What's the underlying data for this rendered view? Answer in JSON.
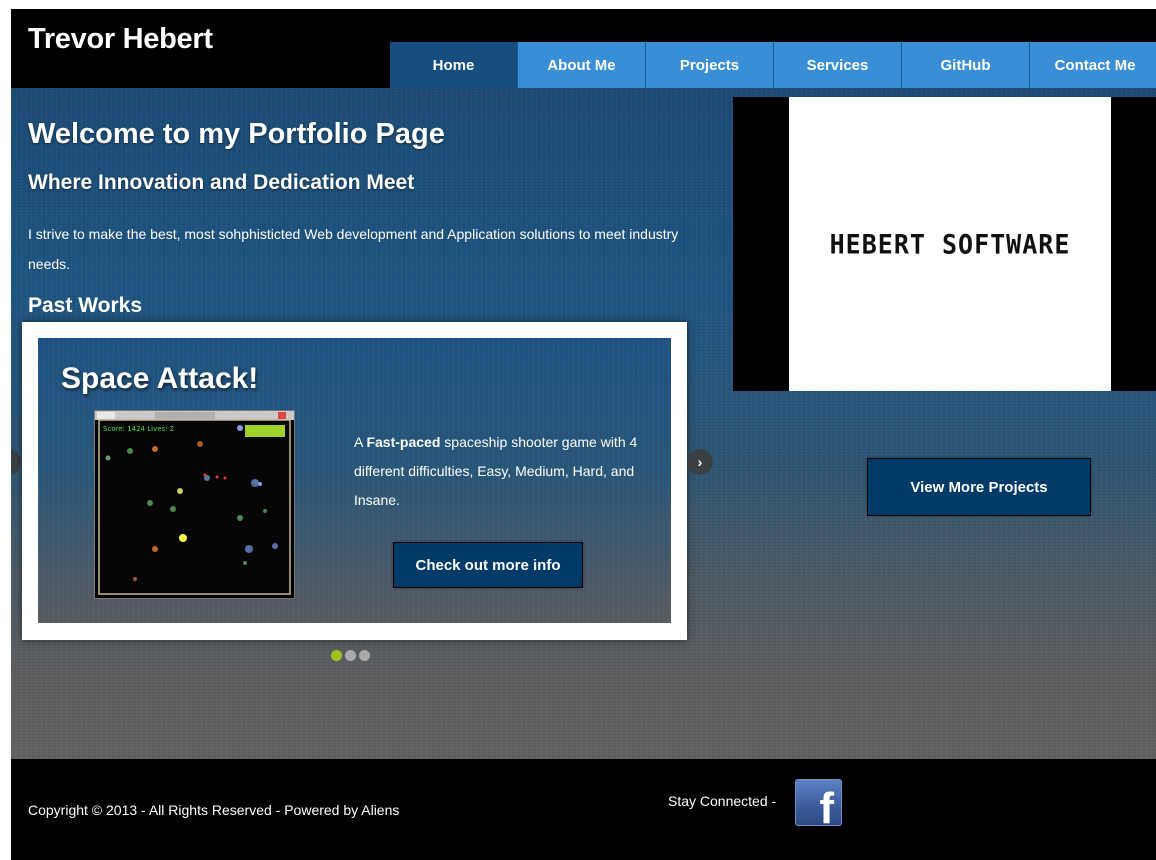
{
  "header": {
    "site_title": "Trevor Hebert"
  },
  "nav": {
    "items": [
      {
        "label": "Home",
        "active": true
      },
      {
        "label": "About Me"
      },
      {
        "label": "Projects"
      },
      {
        "label": "Services"
      },
      {
        "label": "GitHub"
      },
      {
        "label": "Contact Me"
      }
    ]
  },
  "intro": {
    "heading": "Welcome to my Portfolio Page",
    "subheading": "Where Innovation and Dedication Meet",
    "text": "I strive to make the best, most sohphisticted Web development and Application solutions to meet industry needs.",
    "past_works_heading": "Past Works"
  },
  "logo": {
    "text": "HEBERT SOFTWARE"
  },
  "carousel": {
    "slide_title": "Space Attack!",
    "desc_prefix": "A ",
    "desc_bold": "Fast-paced",
    "desc_rest": " spaceship shooter game with 4 different difficulties, Easy, Medium, Hard, and Insane.",
    "button_label": "Check out more info",
    "game_hud": "Score: 1424  Lives: 2",
    "prev_icon": "‹",
    "next_icon": "›",
    "slide_count": 3,
    "active_slide": 1
  },
  "view_more_label": "View More Projects",
  "footer": {
    "copyright": "Copyright © 2013 - All Rights Reserved - Powered by Aliens",
    "stay_connected": "Stay Connected -",
    "facebook_glyph": "f"
  },
  "colors": {
    "nav_active": "#174e80",
    "nav_item": "#3a8ed6",
    "button": "#003a66",
    "dot_active": "#9cc41e",
    "dot": "#aaaaaa",
    "facebook": "#3b5b9a"
  }
}
